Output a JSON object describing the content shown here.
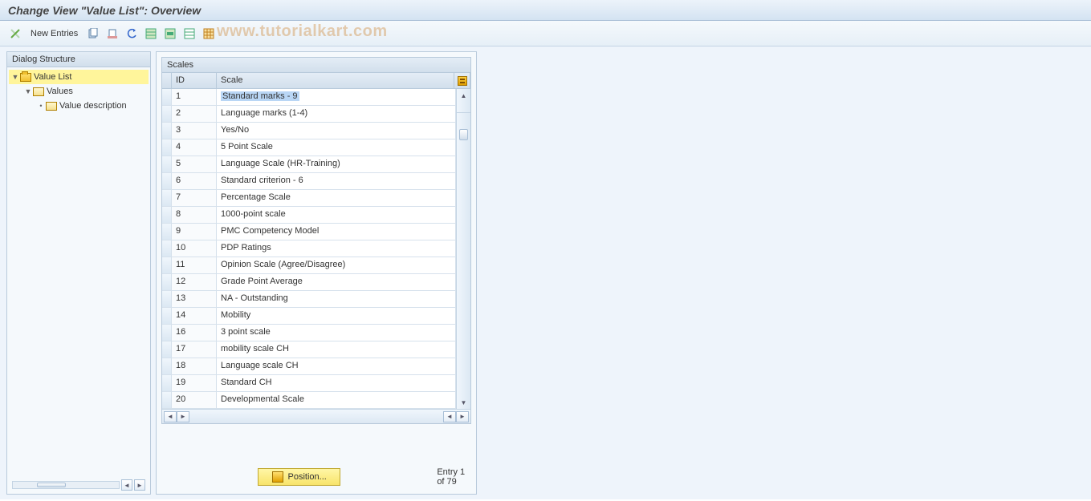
{
  "title": "Change View \"Value List\": Overview",
  "toolbar": {
    "new_entries": "New Entries"
  },
  "watermark": "www.tutorialkart.com",
  "dialog": {
    "header": "Dialog Structure",
    "tree": {
      "root": "Value List",
      "child": "Values",
      "grandchild": "Value description"
    }
  },
  "grid": {
    "title": "Scales",
    "col_id": "ID",
    "col_scale": "Scale",
    "rows": [
      {
        "id": "1",
        "scale": "Standard marks - 9"
      },
      {
        "id": "2",
        "scale": "Language marks (1-4)"
      },
      {
        "id": "3",
        "scale": "Yes/No"
      },
      {
        "id": "4",
        "scale": "5 Point Scale"
      },
      {
        "id": "5",
        "scale": "Language Scale (HR-Training)"
      },
      {
        "id": "6",
        "scale": "Standard criterion - 6"
      },
      {
        "id": "7",
        "scale": "Percentage Scale"
      },
      {
        "id": "8",
        "scale": "1000-point scale"
      },
      {
        "id": "9",
        "scale": "PMC Competency Model"
      },
      {
        "id": "10",
        "scale": "PDP Ratings"
      },
      {
        "id": "11",
        "scale": "Opinion Scale (Agree/Disagree)"
      },
      {
        "id": "12",
        "scale": "Grade Point Average"
      },
      {
        "id": "13",
        "scale": "NA - Outstanding"
      },
      {
        "id": "14",
        "scale": "Mobility"
      },
      {
        "id": "16",
        "scale": "3 point scale"
      },
      {
        "id": "17",
        "scale": "mobility scale CH"
      },
      {
        "id": "18",
        "scale": "Language scale CH"
      },
      {
        "id": "19",
        "scale": "Standard CH"
      },
      {
        "id": "20",
        "scale": "Developmental Scale"
      }
    ]
  },
  "footer": {
    "position": "Position...",
    "entry": "Entry 1 of 79"
  }
}
